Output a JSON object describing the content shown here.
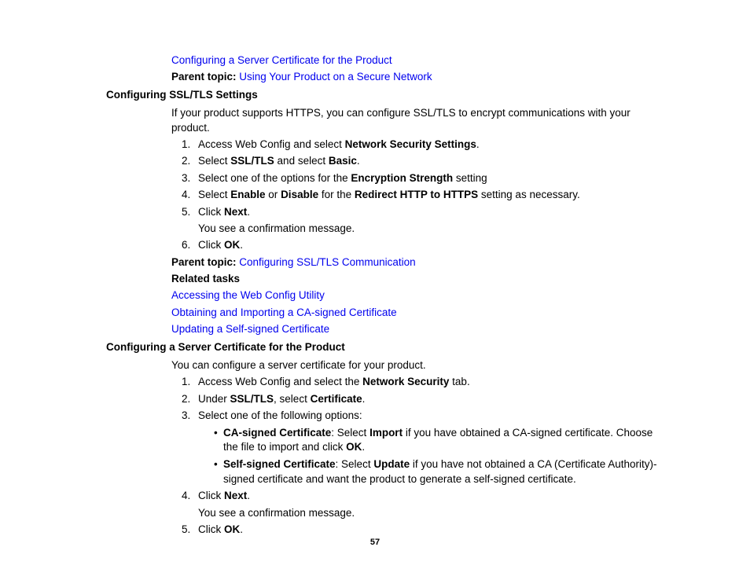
{
  "top": {
    "link1": "Configuring a Server Certificate for the Product",
    "parent_label": "Parent topic:",
    "parent_link": "Using Your Product on a Secure Network"
  },
  "sec1": {
    "heading": "Configuring SSL/TLS Settings",
    "intro": "If your product supports HTTPS, you can configure SSL/TLS to encrypt communications with your product.",
    "s1a": "Access Web Config and select ",
    "s1b": "Network Security Settings",
    "s1c": ".",
    "s2a": "Select ",
    "s2b": "SSL/TLS",
    "s2c": " and select ",
    "s2d": "Basic",
    "s2e": ".",
    "s3a": "Select one of the options for the ",
    "s3b": "Encryption Strength",
    "s3c": " setting",
    "s4a": "Select ",
    "s4b": "Enable",
    "s4c": " or ",
    "s4d": "Disable",
    "s4e": " for the ",
    "s4f": "Redirect HTTP to HTTPS",
    "s4g": " setting as necessary.",
    "s5a": "Click ",
    "s5b": "Next",
    "s5c": ".",
    "s5note": "You see a confirmation message.",
    "s6a": "Click ",
    "s6b": "OK",
    "s6c": ".",
    "parent_label": "Parent topic:",
    "parent_link": "Configuring SSL/TLS Communication",
    "related_heading": "Related tasks",
    "rel1": "Accessing the Web Config Utility",
    "rel2": "Obtaining and Importing a CA-signed Certificate",
    "rel3": "Updating a Self-signed Certificate"
  },
  "sec2": {
    "heading": "Configuring a Server Certificate for the Product",
    "intro": "You can configure a server certificate for your product.",
    "s1a": "Access Web Config and select the ",
    "s1b": "Network Security",
    "s1c": " tab.",
    "s2a": "Under ",
    "s2b": "SSL/TLS",
    "s2c": ", select ",
    "s2d": "Certificate",
    "s2e": ".",
    "s3": "Select one of the following options:",
    "b1a": "CA-signed Certificate",
    "b1b": ": Select ",
    "b1c": "Import",
    "b1d": " if you have obtained a CA-signed certificate. Choose the file to import and click ",
    "b1e": "OK",
    "b1f": ".",
    "b2a": "Self-signed Certificate",
    "b2b": ": Select ",
    "b2c": "Update",
    "b2d": " if you have not obtained a CA (Certificate Authority)-signed certificate and want the product to generate a self-signed certificate.",
    "s4a": "Click ",
    "s4b": "Next",
    "s4c": ".",
    "s4note": "You see a confirmation message.",
    "s5a": "Click ",
    "s5b": "OK",
    "s5c": "."
  },
  "pagenum": "57"
}
